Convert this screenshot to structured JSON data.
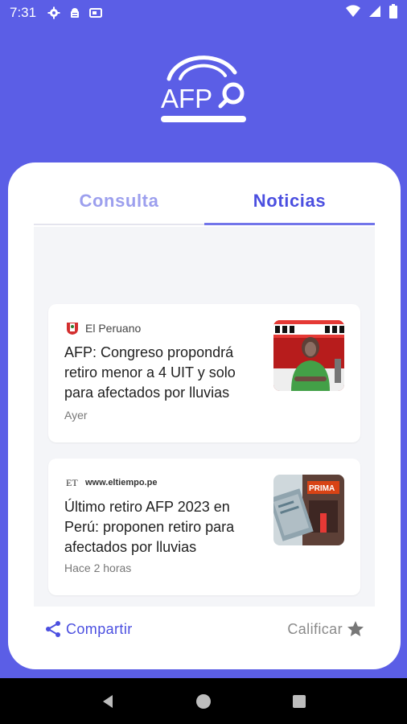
{
  "status_bar": {
    "time": "7:31",
    "icons": [
      "gear-icon",
      "android-debug-icon",
      "sim-card-icon"
    ],
    "right_icons": [
      "wifi-icon",
      "signal-icon",
      "battery-icon"
    ]
  },
  "app": {
    "logo_text": "AFP",
    "accent_color": "#5b5ee6"
  },
  "tabs": [
    {
      "label": "Consulta",
      "active": false
    },
    {
      "label": "Noticias",
      "active": true
    }
  ],
  "news": [
    {
      "source": "El Peruano",
      "headline": "AFP: Congreso propondrá retiro menor a 4 UIT y solo para afectados por lluvias",
      "age": "Ayer",
      "thumb_icon": "news-thumbnail-woman-speaking"
    },
    {
      "source": "www.eltiempo.pe",
      "headline": "Último retiro AFP 2023 en Perú: proponen retiro para afectados por lluvias",
      "age": "Hace 2 horas",
      "thumb_icon": "news-thumbnail-prima-afp"
    }
  ],
  "footer": {
    "share_label": "Compartir",
    "rate_label": "Calificar"
  },
  "nav": [
    "back-icon",
    "home-icon",
    "recents-icon"
  ]
}
